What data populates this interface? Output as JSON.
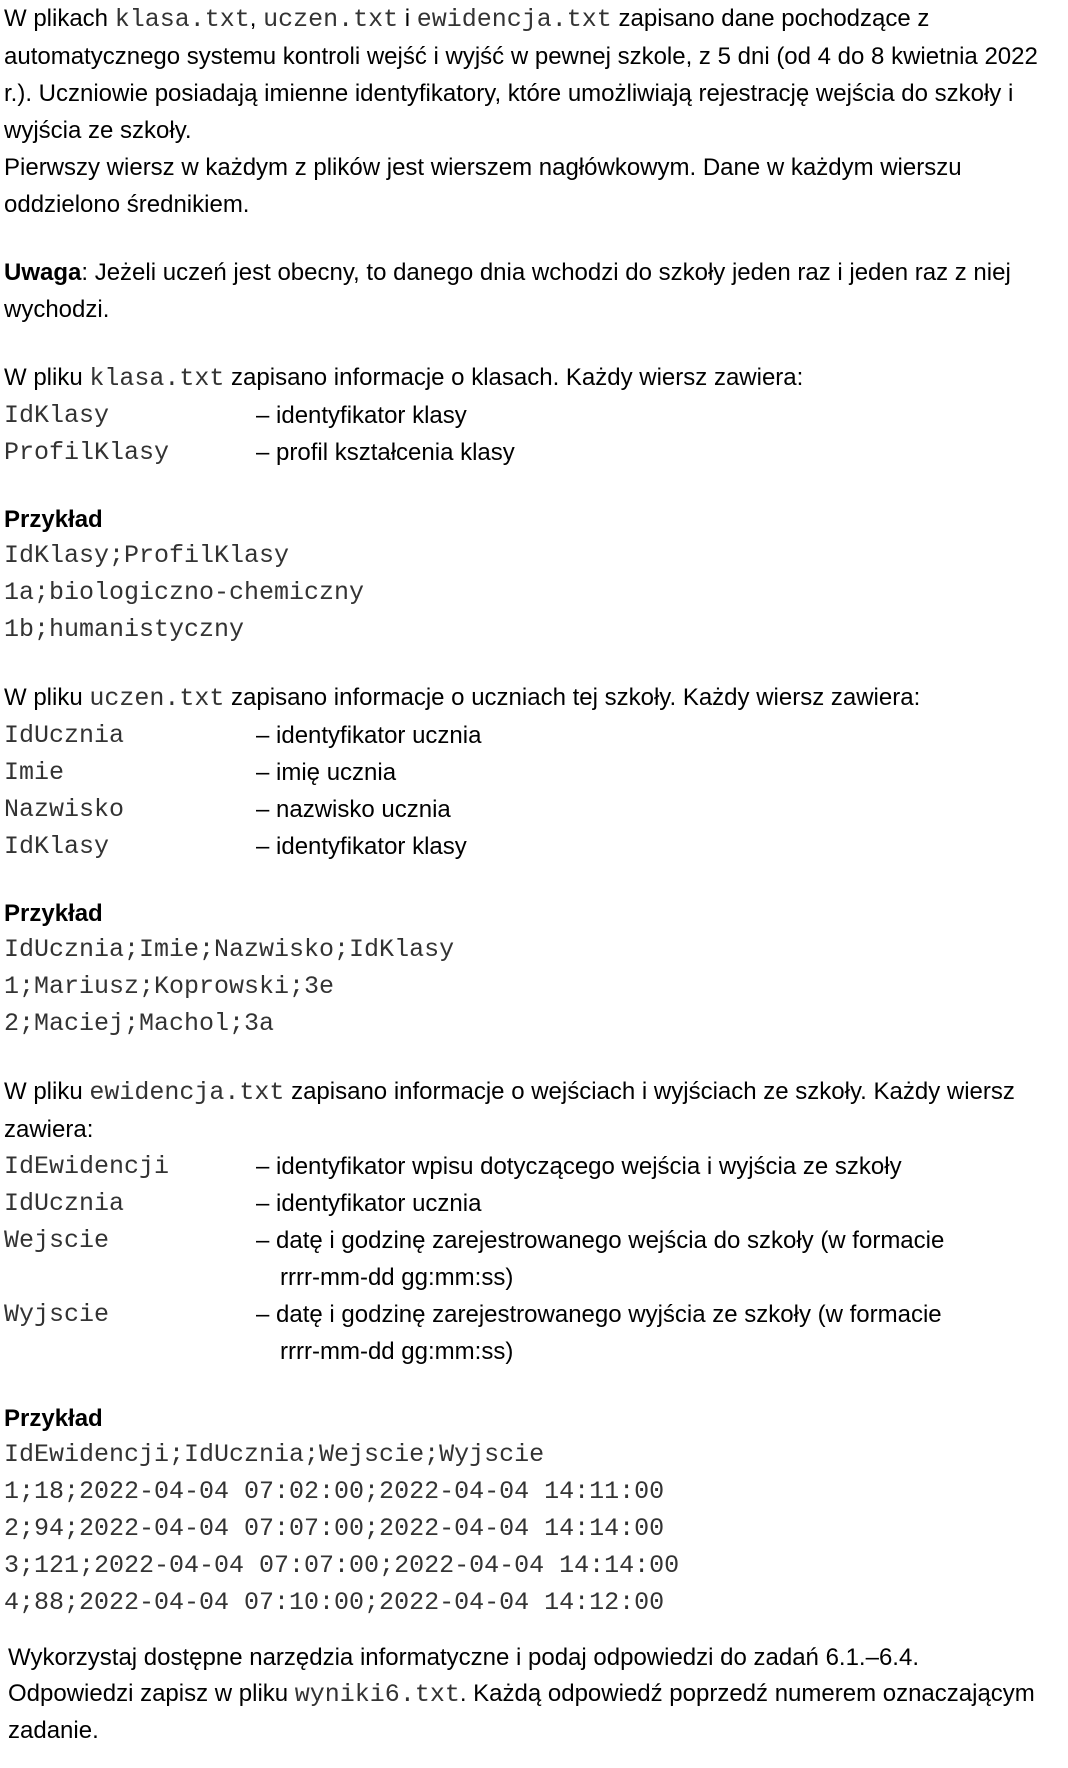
{
  "intro": {
    "p1_a": "W plikach ",
    "p1_f1": "klasa.txt",
    "p1_b": ", ",
    "p1_f2": "uczen.txt",
    "p1_c": " i ",
    "p1_f3": "ewidencja.txt",
    "p1_d": " zapisano dane pochodzące z automatycznego systemu kontroli wejść i wyjść w pewnej szkole, z 5 dni (od 4 do 8 kwietnia 2022 r.). Uczniowie posiadają imienne identyfikatory, które umożliwiają rejestrację wejścia do szkoły i wyjścia ze szkoły.",
    "p2": "Pierwszy wiersz w każdym z plików jest wierszem nagłówkowym. Dane w każdym wierszu oddzielono średnikiem.",
    "note_label": "Uwaga",
    "note_text": ": Jeżeli uczeń jest obecny, to danego dnia wchodzi do szkoły jeden raz i jeden raz z niej wychodzi."
  },
  "klasa": {
    "lead_a": "W pliku ",
    "file": "klasa.txt",
    "lead_b": " zapisano informacje o klasach. Każdy wiersz zawiera:",
    "fields": [
      {
        "name": "IdKlasy",
        "desc": "– identyfikator klasy"
      },
      {
        "name": "ProfilKlasy",
        "desc": "– profil kształcenia klasy"
      }
    ],
    "example_label": "Przykład",
    "example_lines": [
      "IdKlasy;ProfilKlasy",
      "1a;biologiczno-chemiczny",
      "1b;humanistyczny"
    ]
  },
  "uczen": {
    "lead_a": "W pliku ",
    "file": "uczen.txt",
    "lead_b": " zapisano informacje o uczniach tej szkoły. Każdy wiersz zawiera:",
    "fields": [
      {
        "name": "IdUcznia",
        "desc": "– identyfikator ucznia"
      },
      {
        "name": "Imie",
        "desc": "– imię ucznia"
      },
      {
        "name": "Nazwisko",
        "desc": "– nazwisko ucznia"
      },
      {
        "name": "IdKlasy",
        "desc": "– identyfikator klasy"
      }
    ],
    "example_label": "Przykład",
    "example_lines": [
      "IdUcznia;Imie;Nazwisko;IdKlasy",
      "1;Mariusz;Koprowski;3e",
      "2;Maciej;Machol;3a"
    ]
  },
  "ewidencja": {
    "lead_a": "W pliku ",
    "file": "ewidencja.txt",
    "lead_b": " zapisano informacje o wejściach i wyjściach ze szkoły. Każdy wiersz zawiera:",
    "fields": [
      {
        "name": "IdEwidencji",
        "desc": "– identyfikator wpisu dotyczącego wejścia i wyjścia ze szkoły",
        "cont": ""
      },
      {
        "name": "IdUcznia",
        "desc": "– identyfikator ucznia",
        "cont": ""
      },
      {
        "name": "Wejscie",
        "desc": "– datę i godzinę zarejestrowanego wejścia do szkoły (w formacie",
        "cont": "rrrr-mm-dd gg:mm:ss)"
      },
      {
        "name": "Wyjscie",
        "desc": "– datę i godzinę zarejestrowanego wyjścia ze szkoły (w formacie",
        "cont": "rrrr-mm-dd gg:mm:ss)"
      }
    ],
    "example_label": "Przykład",
    "example_lines": [
      "IdEwidencji;IdUcznia;Wejscie;Wyjscie",
      "1;18;2022-04-04 07:02:00;2022-04-04 14:11:00",
      "2;94;2022-04-04 07:07:00;2022-04-04 14:14:00",
      "3;121;2022-04-04 07:07:00;2022-04-04 14:14:00",
      "4;88;2022-04-04 07:10:00;2022-04-04 14:12:00"
    ]
  },
  "footer": {
    "text_a": "Wykorzystaj dostępne narzędzia informatyczne i podaj odpowiedzi do zadań 6.1.–6.4. Odpowiedzi zapisz w pliku ",
    "file": "wyniki6.txt",
    "text_b": ". Każdą odpowiedź poprzedź numerem oznaczającym zadanie."
  }
}
